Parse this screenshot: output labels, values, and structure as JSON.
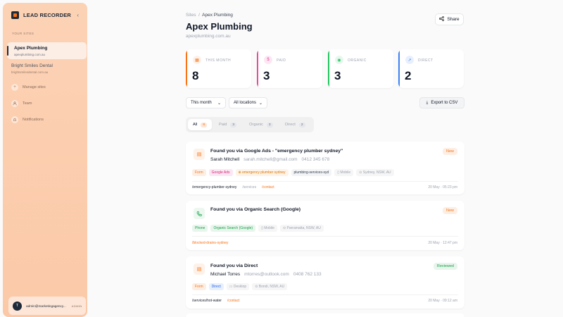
{
  "sidebar": {
    "brand": "LEAD RECORDER",
    "collapse_glyph": "‹",
    "section_label": "Your sites",
    "sites": [
      {
        "name": "Apex Plumbing",
        "domain": "apexplumbing.com.au"
      },
      {
        "name": "Bright Smiles Dental",
        "domain": "brightsmilesdental.com.au"
      }
    ],
    "nav": [
      {
        "label": "Manage sites",
        "icon": "plus-icon"
      },
      {
        "label": "Team",
        "icon": "users-icon"
      },
      {
        "label": "Notifications",
        "icon": "bell-icon"
      }
    ],
    "user": {
      "initial": "T",
      "email": "admin@marketingagency...",
      "role": "ADMIN"
    }
  },
  "header": {
    "breadcrumb_root": "Sites",
    "breadcrumb_sep": "/",
    "breadcrumb_current": "Apex Plumbing",
    "title": "Apex Plumbing",
    "domain": "apexplumbing.com.au",
    "share_label": "Share"
  },
  "stats": [
    {
      "label": "THIS MONTH",
      "value": "8",
      "color": "#f97316",
      "icon": "calendar-icon"
    },
    {
      "label": "PAID",
      "value": "3",
      "color": "#ec4899",
      "icon": "dollar-icon"
    },
    {
      "label": "ORGANIC",
      "value": "3",
      "color": "#22c55e",
      "icon": "globe-icon"
    },
    {
      "label": "DIRECT",
      "value": "2",
      "color": "#3b82f6",
      "icon": "direct-icon"
    }
  ],
  "filters": {
    "period": "This month",
    "location": "All locations",
    "export_label": "Export to CSV"
  },
  "tabs": [
    {
      "label": "All",
      "count": "8"
    },
    {
      "label": "Paid",
      "count": "3"
    },
    {
      "label": "Organic",
      "count": "3"
    },
    {
      "label": "Direct",
      "count": "2"
    }
  ],
  "leads": [
    {
      "title": "Found you via Google Ads - \"emergency plumber sydney\"",
      "name": "Sarah Mitchell",
      "email": "sarah.mitchell@gmail.com",
      "phone": "0412 345 678",
      "status": "New",
      "chips": [
        "Form",
        "Google Ads",
        "⊕ emergency plumber sydney",
        "plumbing-services-syd",
        "▯ Mobile",
        "⊙ Sydney, NSW, AU"
      ],
      "path": [
        "/emergency-plumber-sydney",
        "/services",
        "/contact"
      ],
      "time": "20 May · 05:23 pm"
    },
    {
      "title": "Found you via Organic Search (Google)",
      "status": "New",
      "chips": [
        "Phone",
        "Organic Search (Google)",
        "▯ Mobile",
        "⊙ Parramatta, NSW, AU"
      ],
      "path": [
        "/blocked-drains-sydney"
      ],
      "time": "20 May · 12:47 pm"
    },
    {
      "title": "Found you via Direct",
      "name": "Michael Torres",
      "email": "mtorres@outlook.com",
      "phone": "0408 762 133",
      "status": "Reviewed",
      "chips": [
        "Form",
        "Direct",
        "▭ Desktop",
        "⊙ Bondi, NSW, AU"
      ],
      "path": [
        "/services/hot-water",
        "/contact"
      ],
      "time": "20 May · 09:12 am"
    }
  ]
}
